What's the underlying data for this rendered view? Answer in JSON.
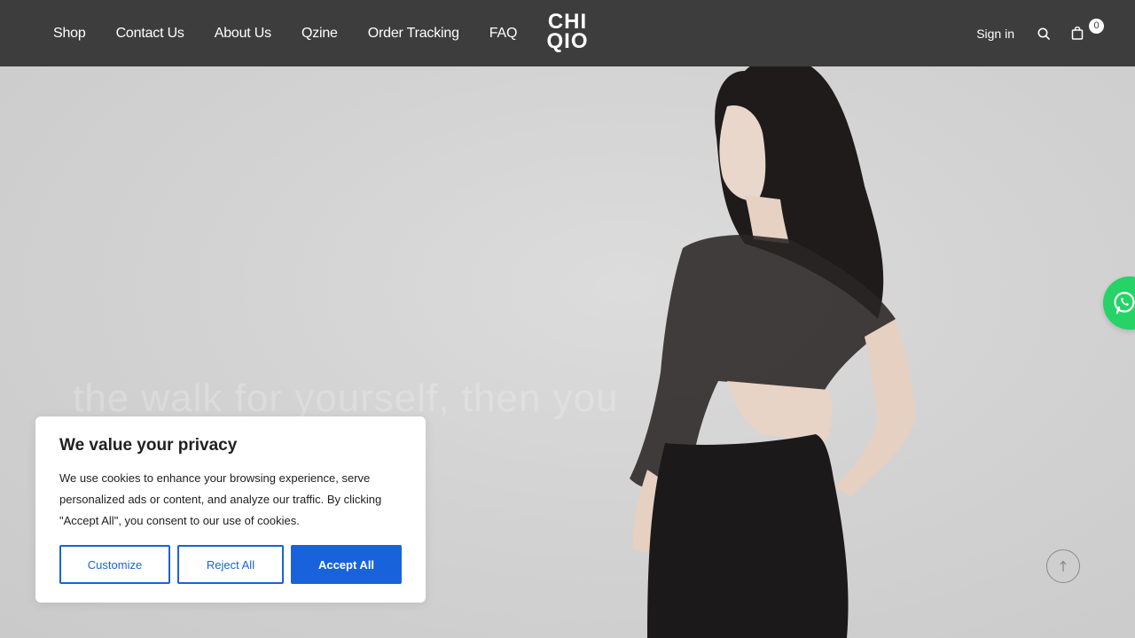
{
  "brand": {
    "logo_line1": "CHI",
    "logo_line2": "QIO"
  },
  "nav": {
    "items": [
      {
        "label": "Shop"
      },
      {
        "label": "Contact Us"
      },
      {
        "label": "About Us"
      },
      {
        "label": "Qzine"
      },
      {
        "label": "Order Tracking"
      },
      {
        "label": "FAQ"
      }
    ]
  },
  "header": {
    "signin_label": "Sign in",
    "cart_count": "0"
  },
  "hero": {
    "tagline": "the walk for yourself, then you"
  },
  "cookie_banner": {
    "title": "We value your privacy",
    "body": "We use cookies to enhance your browsing experience, serve personalized ads or content, and analyze our traffic. By clicking \"Accept All\", you consent to our use of cookies.",
    "customize_label": "Customize",
    "reject_label": "Reject All",
    "accept_label": "Accept All"
  },
  "colors": {
    "header_bg": "#3d3d3d",
    "cookie_accent": "#1863dc",
    "whatsapp": "#25d366"
  },
  "icons": [
    "search-icon",
    "cart-icon",
    "whatsapp-icon",
    "arrow-up-icon"
  ]
}
